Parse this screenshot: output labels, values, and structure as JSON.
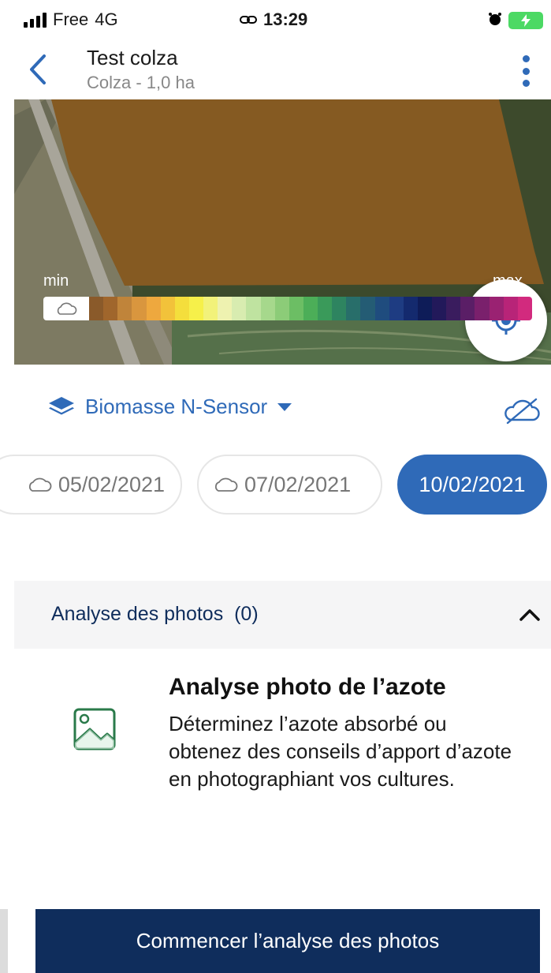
{
  "status_bar": {
    "carrier": "Free",
    "network": "4G",
    "time": "13:29",
    "icons": [
      "signal-icon",
      "link-icon",
      "alarm-icon",
      "battery-charging-icon"
    ]
  },
  "header": {
    "title": "Test colza",
    "subtitle": "Colza - 1,0 ha",
    "back_icon": "chevron-left-icon",
    "more_icon": "more-vertical-icon"
  },
  "map": {
    "field_color": "#855a22",
    "legend": {
      "min_label": "min",
      "max_label": "max",
      "colors": [
        "#8a5a2a",
        "#a0662c",
        "#c0843a",
        "#d9963e",
        "#eea83e",
        "#f2c23a",
        "#f4de3c",
        "#f6f04a",
        "#f2f27a",
        "#eef2b0",
        "#d8ecb0",
        "#bfe3a0",
        "#a6d88c",
        "#8ccc78",
        "#6cbe64",
        "#4cae58",
        "#3a9a5a",
        "#2e8460",
        "#286e6a",
        "#245c74",
        "#1f4c7e",
        "#1e3c82",
        "#142a6e",
        "#0e1c58",
        "#22195a",
        "#3a1c5e",
        "#5a1e66",
        "#7a206c",
        "#9a2272",
        "#b82478",
        "#d22a7e"
      ]
    },
    "locate_icon": "crosshair-icon"
  },
  "layer": {
    "label": "Biomasse N-Sensor",
    "icon": "layers-icon",
    "cloud_toggle_icon": "cloud-off-icon"
  },
  "dates": [
    {
      "label": "05/02/2021",
      "cloudy": true,
      "active": false
    },
    {
      "label": "07/02/2021",
      "cloudy": true,
      "active": false
    },
    {
      "label": "10/02/2021",
      "cloudy": false,
      "active": true
    }
  ],
  "photos_section": {
    "title": "Analyse des photos",
    "count": "(0)",
    "expanded": true
  },
  "analysis": {
    "title": "Analyse photo de l’azote",
    "description": "Déterminez l’azote absorbé ou obtenez des conseils d’apport d’azote en photographiant vos cultures.",
    "icon": "image-icon"
  },
  "cta": {
    "label": "Commencer l’analyse des photos"
  },
  "colors": {
    "accent": "#2f6ab8",
    "navy": "#0f2d5c",
    "section_bg": "#f5f5f6"
  }
}
